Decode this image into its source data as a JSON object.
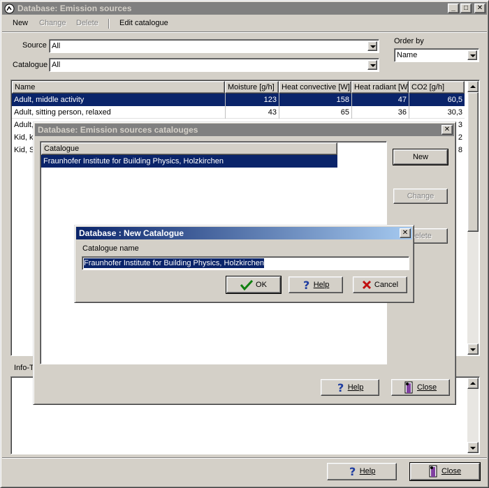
{
  "main": {
    "title": "Database: Emission sources",
    "menu": {
      "new": "New",
      "change": "Change",
      "delete": "Delete",
      "edit_catalogue": "Edit catalogue"
    },
    "filters": {
      "source_label": "Source",
      "source_value": "All",
      "catalogue_label": "Catalogue",
      "catalogue_value": "All",
      "order_label": "Order by",
      "order_value": "Name"
    },
    "table": {
      "headers": [
        "Name",
        "Moisture [g/h]",
        "Heat convective [W]",
        "Heat radiant [W]",
        "CO2 [g/h]"
      ],
      "rows": [
        [
          "Adult, middle activity",
          "123",
          "158",
          "47",
          "60,5"
        ],
        [
          "Adult, sitting person, relaxed",
          "43",
          "65",
          "36",
          "30,3"
        ],
        [
          "Adult,",
          "",
          "",
          "",
          "3"
        ],
        [
          "Kid, ki",
          "",
          "",
          "",
          "2"
        ],
        [
          "Kid, S",
          "",
          "",
          "",
          "8"
        ]
      ]
    },
    "info_label": "Info-T",
    "help_button": "Help",
    "close_button": "Close"
  },
  "catalogues": {
    "title": "Database: Emission sources catalouges",
    "column": "Catalogue",
    "items": [
      "Fraunhofer Institute for Building Physics, Holzkirchen"
    ],
    "new_button": "New",
    "change_button": "Change",
    "delete_button": "Delete",
    "help_button": "Help",
    "close_button": "Close"
  },
  "new_catalogue": {
    "title": "Database : New Catalogue",
    "field_label": "Catalogue name",
    "field_value": "Fraunhofer Institute for Building Physics, Holzkirchen",
    "ok_button": "OK",
    "help_button": "Help",
    "cancel_button": "Cancel"
  },
  "colors": {
    "selection": "#0a246a",
    "face": "#d4d0c8",
    "active_title": "#0a246a"
  },
  "icons": [
    "app-icon",
    "minimize-icon",
    "maximize-icon",
    "close-icon",
    "help-icon",
    "exit-door-icon",
    "check-icon",
    "x-icon",
    "chevron-down-icon",
    "chevron-up-icon"
  ]
}
